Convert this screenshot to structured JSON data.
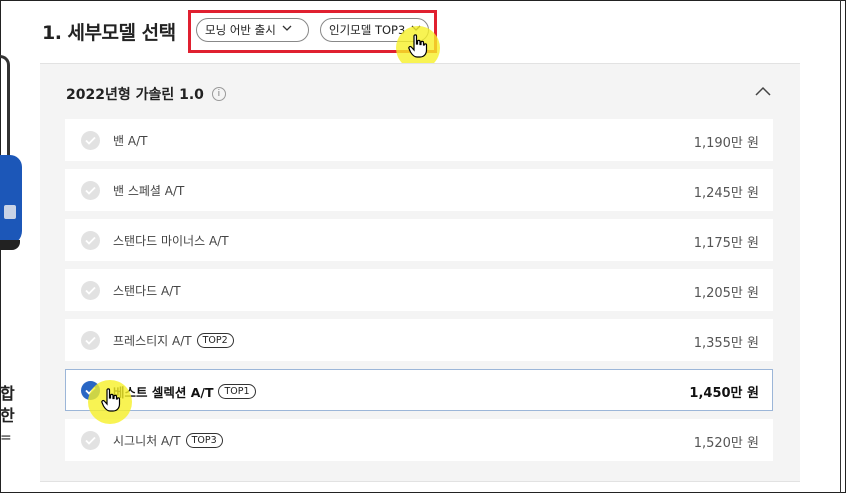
{
  "page": {
    "section_title": "1. 세부모델 선택",
    "filters": [
      {
        "label": "모닝 어반 출시"
      },
      {
        "label": "인기모델 TOP3"
      }
    ],
    "left_fragment": {
      "line1": "합한",
      "line2": "="
    }
  },
  "panel": {
    "header": "2022년형 가솔린 1.0",
    "info_icon_glyph": "i",
    "options": [
      {
        "name": "밴 A/T",
        "badge": "",
        "price": "1,190만 원",
        "selected": false
      },
      {
        "name": "밴 스페셜 A/T",
        "badge": "",
        "price": "1,245만 원",
        "selected": false
      },
      {
        "name": "스탠다드 마이너스 A/T",
        "badge": "",
        "price": "1,175만 원",
        "selected": false
      },
      {
        "name": "스탠다드 A/T",
        "badge": "",
        "price": "1,205만 원",
        "selected": false
      },
      {
        "name": "프레스티지 A/T",
        "badge": "TOP2",
        "price": "1,355만 원",
        "selected": false
      },
      {
        "name": "베스트 셀렉션 A/T",
        "badge": "TOP1",
        "price": "1,450만 원",
        "selected": true
      },
      {
        "name": "시그니처 A/T",
        "badge": "TOP3",
        "price": "1,520만 원",
        "selected": false
      }
    ]
  },
  "icons": {
    "check": "check-icon",
    "chevron_down": "chevron-down-icon",
    "chevron_up": "chevron-up-icon",
    "info": "info-icon",
    "hand_cursor": "hand-cursor-icon"
  },
  "colors": {
    "highlight_border": "#e02030",
    "selected_check": "#2966c4",
    "cursor_highlight": "#f6f028"
  }
}
